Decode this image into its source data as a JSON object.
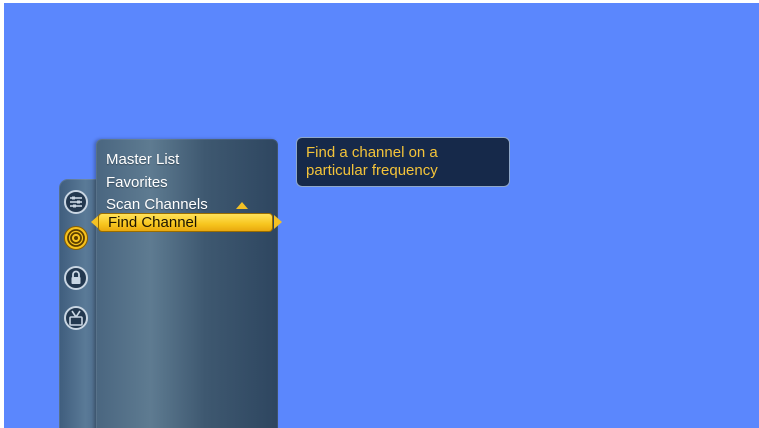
{
  "menu": {
    "items": [
      {
        "label": "Master List"
      },
      {
        "label": "Favorites"
      },
      {
        "label": "Scan Channels"
      },
      {
        "label": "Find Channel"
      }
    ],
    "selected_index": 3
  },
  "sidebar": {
    "icons": [
      {
        "name": "settings-sliders-icon"
      },
      {
        "name": "antenna-signal-icon"
      },
      {
        "name": "lock-icon"
      },
      {
        "name": "tv-antenna-icon"
      }
    ],
    "active_index": 1
  },
  "description": {
    "line1": "Find a channel on a",
    "line2": "particular frequency"
  },
  "colors": {
    "background": "#5b87fd",
    "highlight": "#f7c51e",
    "description_text": "#f3c33a",
    "description_bg": "#16294a"
  }
}
